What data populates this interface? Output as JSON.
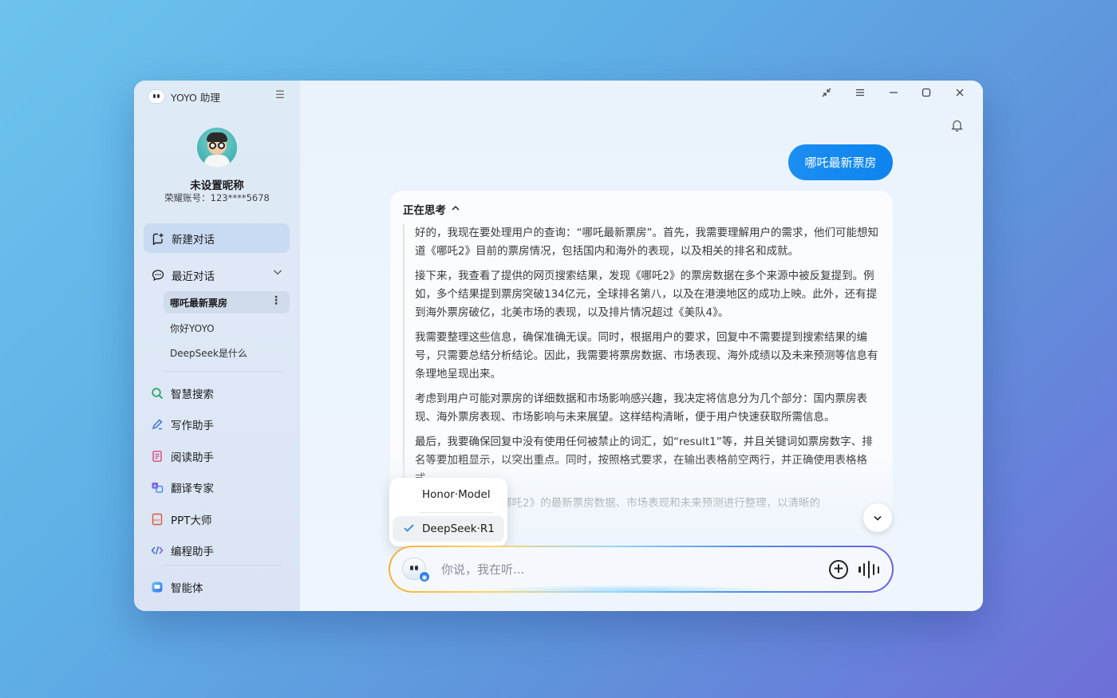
{
  "app": {
    "title": "YOYO 助理"
  },
  "profile": {
    "nickname": "未设置昵称",
    "account": "荣耀账号：123****5678"
  },
  "sidebar": {
    "new_chat": "新建对话",
    "recent_label": "最近对话",
    "history": [
      "哪吒最新票房",
      "你好YOYO",
      "DeepSeek是什么"
    ],
    "tools": [
      {
        "label": "智慧搜索",
        "icon": "search-icon"
      },
      {
        "label": "写作助手",
        "icon": "pen-icon"
      },
      {
        "label": "阅读助手",
        "icon": "document-icon"
      },
      {
        "label": "翻译专家",
        "icon": "translate-icon"
      },
      {
        "label": "PPT大师",
        "icon": "ppt-icon"
      },
      {
        "label": "编程助手",
        "icon": "code-icon"
      }
    ],
    "agent": {
      "label": "智能体",
      "icon": "agent-icon"
    }
  },
  "chat": {
    "user_message": "哪吒最新票房",
    "thinking_label": "正在思考",
    "thinking_paragraphs": [
      "好的，我现在要处理用户的查询：“哪吒最新票房”。首先，我需要理解用户的需求，他们可能想知道《哪吒2》目前的票房情况，包括国内和海外的表现，以及相关的排名和成就。",
      "接下来，我查看了提供的网页搜索结果，发现《哪吒2》的票房数据在多个来源中被反复提到。例如，多个结果提到票房突破134亿元，全球排名第八，以及在港澳地区的成功上映。此外，还有提到海外票房破亿，北美市场的表现，以及排片情况超过《美队4》。",
      "我需要整理这些信息，确保准确无误。同时，根据用户的要求，回复中不需要提到搜索结果的编号，只需要总结分析结论。因此，我需要将票房数据、市场表现、海外成绩以及未来预测等信息有条理地呈现出来。",
      "考虑到用户可能对票房的详细数据和市场影响感兴趣，我决定将信息分为几个部分：国内票房表现、海外票房表现、市场影响与未来展望。这样结构清晰，便于用户快速获取所需信息。",
      "最后，我要确保回复中没有使用任何被禁止的词汇，如“result1”等，并且关键词如票房数字、排名等要加粗显示，以突出重点。同时，按照格式要求，在输出表格前空两行，并正确使用表格格式。",
      "总结一下，我将《哪吒2》的最新票房数据、市场表现和未来预测进行整理，以清晰的"
    ]
  },
  "model_menu": {
    "options": [
      "Honor·Model",
      "DeepSeek·R1"
    ],
    "selected": "DeepSeek·R1"
  },
  "input": {
    "placeholder": "你说，我在听..."
  }
}
